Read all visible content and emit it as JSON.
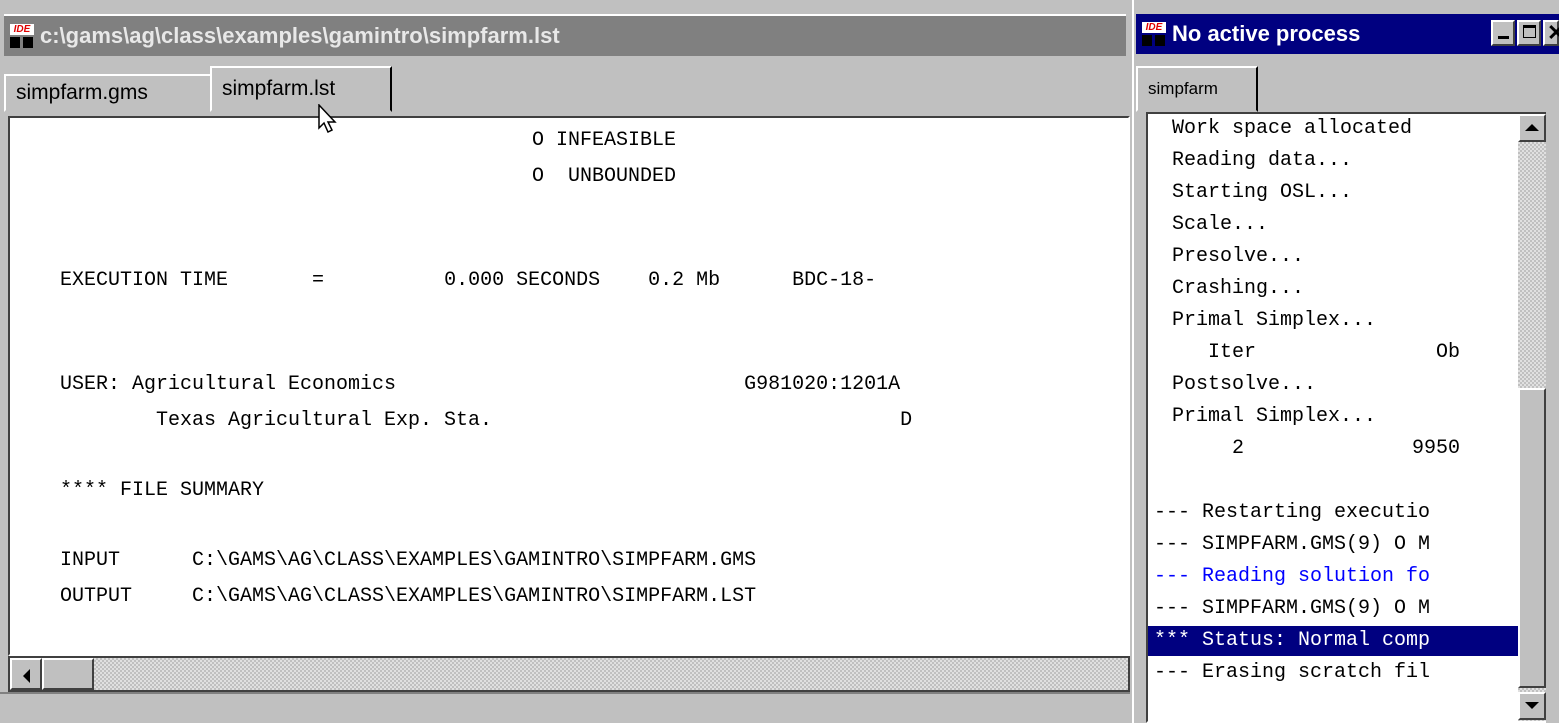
{
  "main_window": {
    "title": "c:\\gams\\ag\\class\\examples\\gamintro\\simpfarm.lst",
    "tabs": [
      {
        "label": "simpfarm.gms",
        "active": false
      },
      {
        "label": "simpfarm.lst",
        "active": true
      }
    ],
    "listing_lines": [
      "O INFEASIBLE",
      "O  UNBOUNDED",
      "EXECUTION TIME       =          0.000 SECONDS    0.2 Mb      BDC-18-",
      "USER: Agricultural Economics                             G981020:1201A",
      "Texas Agricultural Exp. Sta.                                  D",
      "**** FILE SUMMARY",
      "INPUT      C:\\GAMS\\AG\\CLASS\\EXAMPLES\\GAMINTRO\\SIMPFARM.GMS",
      "OUTPUT     C:\\GAMS\\AG\\CLASS\\EXAMPLES\\GAMINTRO\\SIMPFARM.LST"
    ]
  },
  "process_window": {
    "title": "No active process",
    "tab_label": "simpfarm",
    "log_lines": [
      "Work space allocated",
      "Reading data...",
      "Starting OSL...",
      "Scale...",
      "Presolve...",
      "Crashing...",
      "Primal Simplex...",
      "   Iter               Ob",
      "Postsolve...",
      "Primal Simplex...",
      "     2              9950",
      "",
      "--- Restarting executio",
      "--- SIMPFARM.GMS(9) O M",
      "--- Reading solution fo",
      "--- SIMPFARM.GMS(9) O M",
      "*** Status: Normal comp",
      "--- Erasing scratch fil"
    ],
    "highlight_line_index": 16,
    "blue_line_index": 14
  },
  "icons": {
    "app_icon": "ide-icon",
    "app_icon_text": "IDE",
    "minimize": "minimize-icon",
    "maximize": "maximize-icon",
    "close": "close-icon",
    "pointer": "mouse-pointer-icon"
  },
  "colors": {
    "active_title": "#000080",
    "inactive_title": "#808080",
    "highlight": "#000080",
    "blue_text": "#0000ff",
    "window_face": "#c0c0c0"
  }
}
